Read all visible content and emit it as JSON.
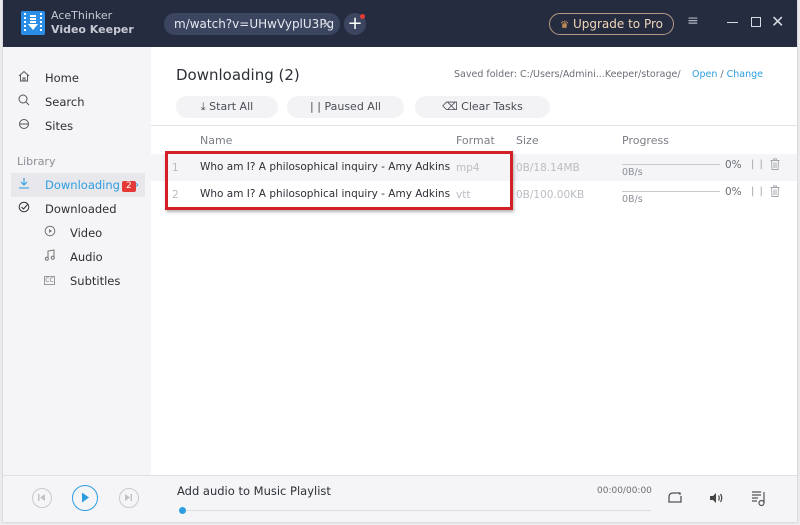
{
  "app": {
    "name_line1": "AceThinker",
    "name_line2": "Video Keeper"
  },
  "titlebar": {
    "url_value": "m/watch?v=UHwVyplU3Pg",
    "url_close": "×",
    "add_label": "+",
    "upgrade_label": "Upgrade to Pro",
    "upgrade_icon": "♛",
    "menu_icon": "≡",
    "close_icon": "✕"
  },
  "sidebar": {
    "items": [
      {
        "label": "Home",
        "icon": "home-icon"
      },
      {
        "label": "Search",
        "icon": "search-icon"
      },
      {
        "label": "Sites",
        "icon": "globe-icon"
      }
    ],
    "library_label": "Library",
    "library": [
      {
        "label": "Downloading",
        "badge": "2",
        "icon": "download-icon",
        "active": true,
        "chevron": "›"
      },
      {
        "label": "Downloaded",
        "icon": "check-circle-icon"
      },
      {
        "label": "Video",
        "icon": "play-circle-icon",
        "sub": true
      },
      {
        "label": "Audio",
        "icon": "music-icon",
        "sub": true
      },
      {
        "label": "Subtitles",
        "icon": "cc-icon",
        "sub": true,
        "glyph": "CC"
      }
    ]
  },
  "main": {
    "title": "Downloading (2)",
    "saved_folder": "Saved folder: C:/Users/Admini...Keeper/storage/",
    "open_label": "Open",
    "separator": " / ",
    "change_label": "Change",
    "toolbar": {
      "start_all": "Start All",
      "start_icon": "⤓",
      "paused_all": "Paused All",
      "paused_icon": "| |",
      "clear_tasks": "Clear Tasks",
      "clear_icon": "⌫"
    },
    "columns": {
      "name": "Name",
      "format": "Format",
      "size": "Size",
      "progress": "Progress"
    },
    "rows": [
      {
        "index": "1",
        "name": "Who am I? A philosophical inquiry - Amy Adkins",
        "format": "mp4",
        "size": "0B/18.14MB",
        "speed": "0B/s",
        "percent_label": "0%",
        "progress": 0,
        "pause": "| |"
      },
      {
        "index": "2",
        "name": "Who am I? A philosophical inquiry - Amy Adkins",
        "format": "vtt",
        "size": "0B/100.00KB",
        "speed": "0B/s",
        "percent_label": "0%",
        "progress": 0,
        "pause": "| |"
      }
    ]
  },
  "player": {
    "title": "Add audio to Music Playlist",
    "time": "00:00/00:00",
    "seek_progress": 0
  },
  "colors": {
    "accent": "#2d9de0",
    "titlebar": "#262c40",
    "badge": "#e53935",
    "highlight": "#d31f26"
  }
}
